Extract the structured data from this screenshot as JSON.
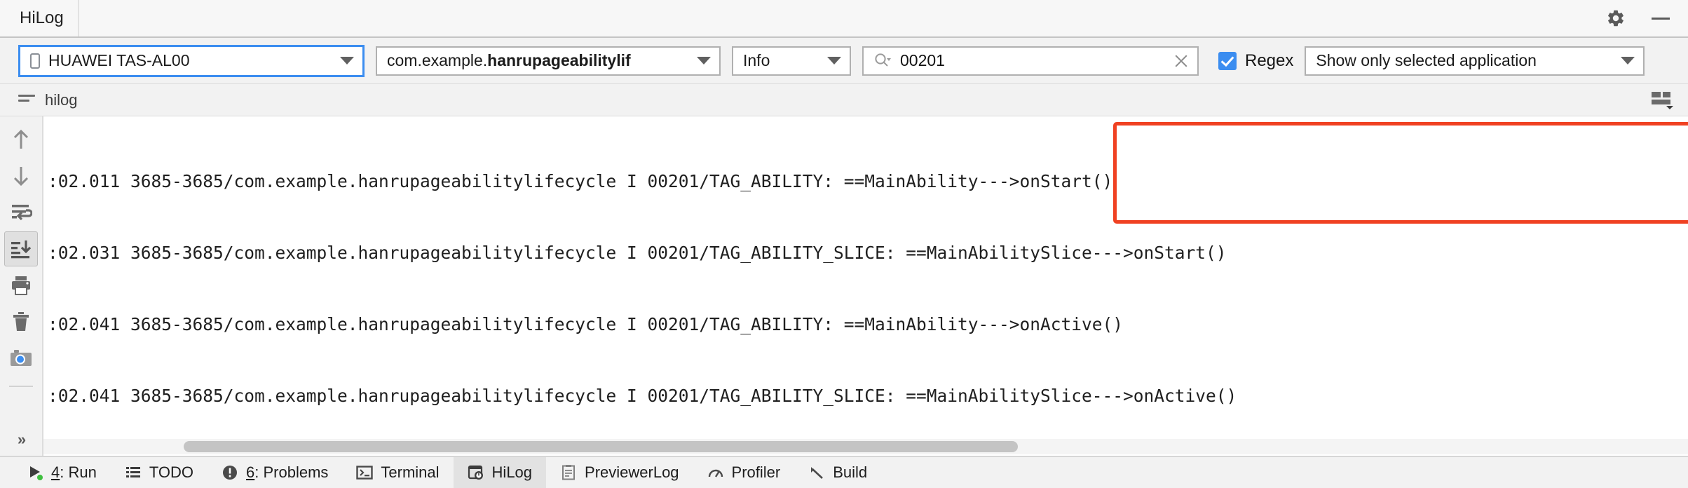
{
  "window": {
    "title": "HiLog",
    "settings_icon": "gear-icon",
    "minimize_icon": "minimize-icon"
  },
  "toolbar": {
    "device": {
      "value": "HUAWEI TAS-AL00",
      "icon": "phone-icon",
      "caret": "chevron-down-icon"
    },
    "package": {
      "prefix": "com.example.",
      "bold": "hanrupageabilitylif",
      "full": "com.example.hanrupageabilitylif",
      "caret": "chevron-down-icon"
    },
    "level": {
      "value": "Info",
      "caret": "chevron-down-icon"
    },
    "search": {
      "value": "00201",
      "placeholder": "",
      "icon": "search-icon",
      "clear_icon": "close-icon"
    },
    "regex": {
      "label": "Regex",
      "checked": true
    },
    "app_filter": {
      "value": "Show only selected application",
      "caret": "chevron-down-icon"
    }
  },
  "subheader": {
    "tab_label": "hilog",
    "tab_icon": "lines-icon",
    "columns_icon": "column-settings-icon"
  },
  "gutter": {
    "buttons": [
      {
        "name": "scroll-up-icon",
        "title": "Up",
        "selected": false
      },
      {
        "name": "scroll-down-icon",
        "title": "Down",
        "selected": false
      },
      {
        "name": "soft-wrap-icon",
        "title": "Soft-Wrap",
        "selected": false
      },
      {
        "name": "scroll-to-end-icon",
        "title": "Scroll to End",
        "selected": true
      },
      {
        "name": "print-icon",
        "title": "Print",
        "selected": false
      },
      {
        "name": "trash-icon",
        "title": "Clear All",
        "selected": false
      },
      {
        "name": "camera-icon",
        "title": "Screenshot",
        "selected": false
      }
    ],
    "expand_label": "»"
  },
  "log": {
    "lines": [
      ":02.011 3685-3685/com.example.hanrupageabilitylifecycle I 00201/TAG_ABILITY: ==MainAbility--->onStart()",
      ":02.031 3685-3685/com.example.hanrupageabilitylifecycle I 00201/TAG_ABILITY_SLICE: ==MainAbilitySlice--->onStart()",
      ":02.041 3685-3685/com.example.hanrupageabilitylifecycle I 00201/TAG_ABILITY: ==MainAbility--->onActive()",
      ":02.041 3685-3685/com.example.hanrupageabilitylifecycle I 00201/TAG_ABILITY_SLICE: ==MainAbilitySlice--->onActive()"
    ],
    "annotation_color": "#f04122"
  },
  "bottom_tabs": [
    {
      "name": "tab-run",
      "num": "4",
      "label": ": Run",
      "icon": "run-icon",
      "active": false
    },
    {
      "name": "tab-todo",
      "num": "",
      "label": "TODO",
      "icon": "todo-icon",
      "active": false
    },
    {
      "name": "tab-problems",
      "num": "6",
      "label": ": Problems",
      "icon": "problems-icon",
      "active": false
    },
    {
      "name": "tab-terminal",
      "num": "",
      "label": "Terminal",
      "icon": "terminal-icon",
      "active": false
    },
    {
      "name": "tab-hilog",
      "num": "",
      "label": "HiLog",
      "icon": "hilog-icon",
      "active": true
    },
    {
      "name": "tab-previewerlog",
      "num": "",
      "label": "PreviewerLog",
      "icon": "previewerlog-icon",
      "active": false
    },
    {
      "name": "tab-profiler",
      "num": "",
      "label": "Profiler",
      "icon": "profiler-icon",
      "active": false
    },
    {
      "name": "tab-build",
      "num": "",
      "label": "Build",
      "icon": "build-icon",
      "active": false
    }
  ],
  "colors": {
    "accent": "#3b8df0",
    "annotation": "#f04122",
    "chrome": "#f2f2f2"
  }
}
